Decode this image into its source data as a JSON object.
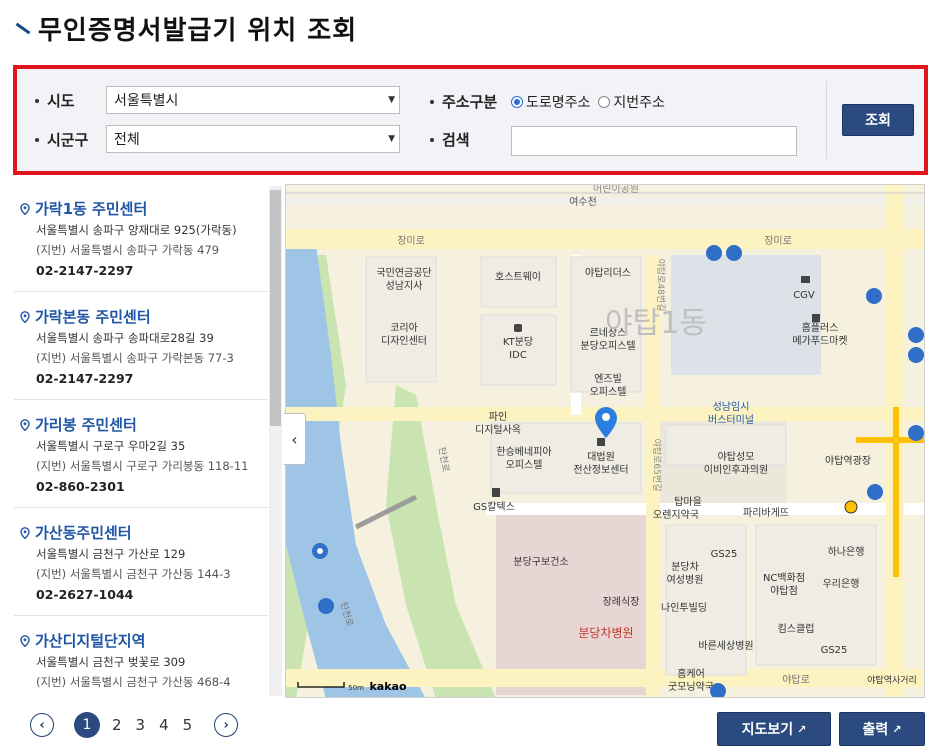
{
  "page": {
    "title": "무인증명서발급기 위치 조회"
  },
  "search": {
    "sido_label": "시도",
    "sido_value": "서울특별시",
    "sigungu_label": "시군구",
    "sigungu_value": "전체",
    "addr_type_label": "주소구분",
    "addr_type_options": [
      "도로명주소",
      "지번주소"
    ],
    "addr_type_selected": "도로명주소",
    "keyword_label": "검색",
    "keyword_value": "",
    "search_button": "조회"
  },
  "results": [
    {
      "name": "가락1동 주민센터",
      "road": "서울특별시 송파구 양재대로 925(가락동)",
      "jibun": "(지번) 서울특별시 송파구 가락동 479",
      "tel": "02-2147-2297"
    },
    {
      "name": "가락본동 주민센터",
      "road": "서울특별시 송파구 송파대로28길 39",
      "jibun": "(지번) 서울특별시 송파구 가락본동 77-3",
      "tel": "02-2147-2297"
    },
    {
      "name": "가리봉 주민센터",
      "road": "서울특별시 구로구 우마2길 35",
      "jibun": "(지번) 서울특별시 구로구 가리봉동 118-11",
      "tel": "02-860-2301"
    },
    {
      "name": "가산동주민센터",
      "road": "서울특별시 금천구 가산로 129",
      "jibun": "(지번) 서울특별시 금천구 가산동 144-3",
      "tel": "02-2627-1044"
    },
    {
      "name": "가산디지털단지역",
      "road": "서울특별시 금천구 벚꽃로 309",
      "jibun": "(지번) 서울특별시 금천구 가산동 468-4",
      "tel": ""
    }
  ],
  "map": {
    "labels": {
      "yeosu": "여수천",
      "jangmi1": "장미로",
      "jangmi2": "장미로",
      "top": "어린이공원",
      "pension1": "국민연금공단",
      "pension2": "성남지사",
      "host": "호스트웨이",
      "yatap_leaders": "야탑리더스",
      "cgv": "CGV",
      "korea1": "코리아",
      "korea2": "디자인센터",
      "kt1": "KT분당",
      "kt2": "IDC",
      "renai1": "르네상스",
      "renai2": "분당오피스텔",
      "homeplus1": "홈플러스",
      "homeplus2": "메가푸드마켓",
      "district": "야탑1동",
      "enzyville1": "엔즈빌",
      "enzyville2": "오피스텔",
      "terminal1": "성남임시",
      "terminal2": "버스터미널",
      "pine1": "파인",
      "pine2": "디지털사옥",
      "hansung1": "한승베네피아",
      "hansung2": "오피스텔",
      "court1": "대법원",
      "court2": "전산정보센터",
      "clinic1": "야탑성모",
      "clinic2": "이비인후과의원",
      "yatap_square": "야탑역광장",
      "gs_caltex": "GS칼텍스",
      "tapmaeul1": "탑마을",
      "tapmaeul2": "오렌지약국",
      "paris": "파리바게뜨",
      "bundang_fire": "분당구보건소",
      "gs25a": "GS25",
      "gs25b": "GS25",
      "hana": "하나은행",
      "woori": "우리은행",
      "women1": "분당차",
      "women2": "여성병원",
      "nc1": "NC백화점",
      "nc2": "야탑점",
      "jangrye": "장례식장",
      "chahospital": "분당차병원",
      "nine": "나인투빌딩",
      "kims": "킴스클럽",
      "bareun": "바른세상병원",
      "homecare1": "홈케어",
      "homecare2": "굿모닝약국",
      "tanbalo": "야탑로",
      "yatap_exit": "야탑역사거리",
      "road_vertical": "야탑로65번길",
      "road_vertical2": "야탑로48번길",
      "river": "탄천로",
      "river2": "탄천로",
      "scale": "50m",
      "brand": "kakao"
    }
  },
  "pagination": {
    "pages": [
      "1",
      "2",
      "3",
      "4",
      "5"
    ],
    "current": "1"
  },
  "actions": {
    "map_view": "지도보기",
    "print": "출력"
  }
}
